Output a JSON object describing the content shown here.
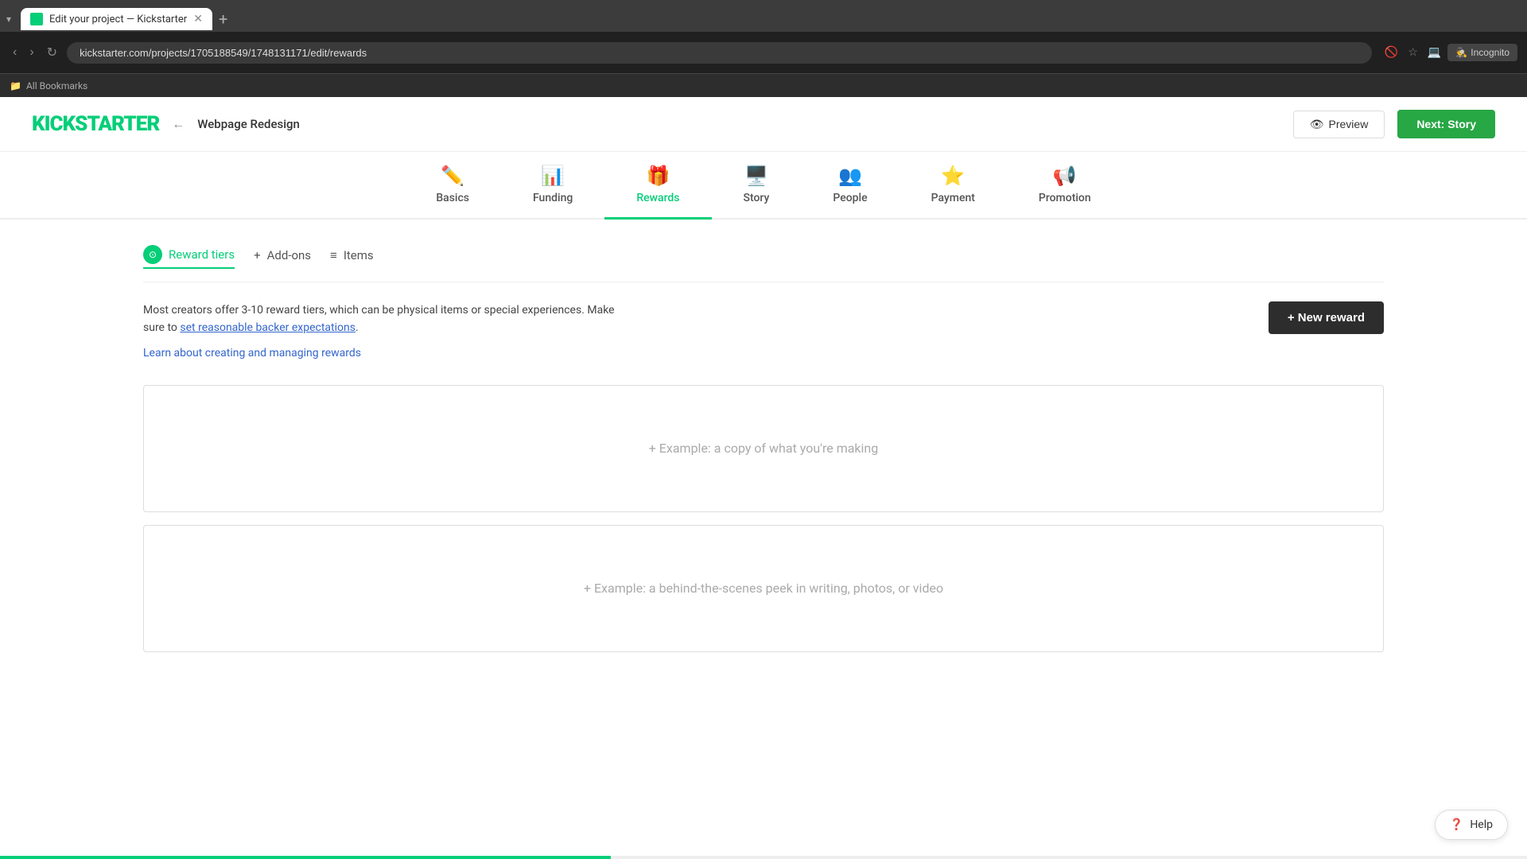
{
  "browser": {
    "tab_label": "Edit your project — Kickstarter",
    "address": "kickstarter.com/projects/1705188549/1748131171/edit/rewards",
    "bookmarks_label": "All Bookmarks",
    "incognito_label": "Incognito"
  },
  "header": {
    "logo": "KICKSTARTER",
    "back_arrow": "←",
    "project_name": "Webpage Redesign",
    "preview_label": "Preview",
    "next_label": "Next: Story"
  },
  "nav": {
    "tabs": [
      {
        "id": "basics",
        "label": "Basics",
        "icon": "✏️"
      },
      {
        "id": "funding",
        "label": "Funding",
        "icon": "📊"
      },
      {
        "id": "rewards",
        "label": "Rewards",
        "icon": "🎁",
        "active": true
      },
      {
        "id": "story",
        "label": "Story",
        "icon": "🖥️"
      },
      {
        "id": "people",
        "label": "People",
        "icon": "👥"
      },
      {
        "id": "payment",
        "label": "Payment",
        "icon": "⭐"
      },
      {
        "id": "promotion",
        "label": "Promotion",
        "icon": "📢"
      }
    ]
  },
  "sub_nav": {
    "items": [
      {
        "id": "reward-tiers",
        "label": "Reward tiers",
        "active": true,
        "has_icon": true
      },
      {
        "id": "add-ons",
        "label": "Add-ons",
        "prefix": "+",
        "active": false
      },
      {
        "id": "items",
        "label": "Items",
        "prefix": "≡",
        "active": false
      }
    ]
  },
  "content": {
    "description": "Most creators offer 3-10 reward tiers, which can be physical items or special experiences. Make sure to",
    "description_link_text": "set reasonable backer expectations",
    "description_suffix": ".",
    "learn_link": "Learn about creating and managing rewards",
    "new_reward_btn": "+ New reward",
    "example_card_1": "+ Example: a copy of what you're making",
    "example_card_2": "+ Example: a behind-the-scenes peek in writing, photos, or video"
  },
  "help": {
    "label": "Help"
  },
  "colors": {
    "green": "#05ce78",
    "dark": "#2d2d2d",
    "next_green": "#28a745"
  }
}
